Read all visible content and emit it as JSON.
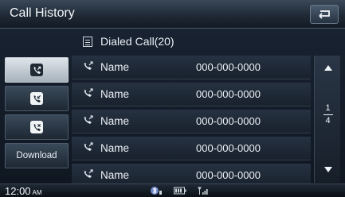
{
  "header": {
    "title": "Call History"
  },
  "list_header": {
    "label": "Dialed Call(20)"
  },
  "tabs": [
    {
      "id": "dialed",
      "icon": "dialed-calls-icon",
      "active": true
    },
    {
      "id": "received",
      "icon": "received-calls-icon",
      "active": false
    },
    {
      "id": "missed",
      "icon": "missed-calls-icon",
      "active": false
    },
    {
      "id": "download",
      "label": "Download",
      "active": false
    }
  ],
  "calls": [
    {
      "name": "Name",
      "number": "000-000-0000"
    },
    {
      "name": "Name",
      "number": "000-000-0000"
    },
    {
      "name": "Name",
      "number": "000-000-0000"
    },
    {
      "name": "Name",
      "number": "000-000-0000"
    },
    {
      "name": "Name",
      "number": "000-000-0000"
    }
  ],
  "pagination": {
    "current": "1",
    "total": "4"
  },
  "status": {
    "time": "12:00",
    "ampm": "AM"
  },
  "colors": {
    "accent": "#dfe5ea",
    "background": "#121a24"
  }
}
